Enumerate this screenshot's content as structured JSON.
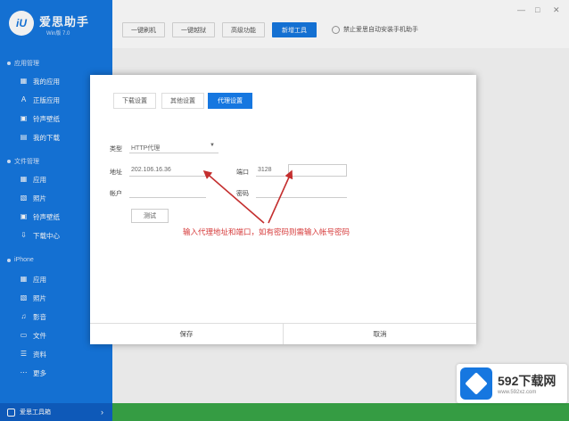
{
  "app": {
    "name": "爱思助手",
    "version": "Win版 7.0"
  },
  "window_controls": [
    "—",
    "□",
    "✕"
  ],
  "sidebar": {
    "groups": [
      {
        "title": "应用管理",
        "items": [
          {
            "label": "我的应用",
            "icon": "apps-icon"
          },
          {
            "label": "正版应用",
            "icon": "appstore-icon"
          },
          {
            "label": "铃声壁纸",
            "icon": "wallpaper-icon"
          },
          {
            "label": "我的下载",
            "icon": "download-icon"
          }
        ]
      },
      {
        "title": "文件管理",
        "items": [
          {
            "label": "应用",
            "icon": "apps-icon"
          },
          {
            "label": "照片",
            "icon": "photo-icon"
          },
          {
            "label": "铃声壁纸",
            "icon": "wallpaper-icon"
          },
          {
            "label": "下载中心",
            "icon": "download-icon"
          }
        ]
      },
      {
        "title": "iPhone",
        "items": [
          {
            "label": "应用",
            "icon": "apps-icon"
          },
          {
            "label": "照片",
            "icon": "photo-icon"
          },
          {
            "label": "影音",
            "icon": "media-icon"
          },
          {
            "label": "文件",
            "icon": "file-icon"
          },
          {
            "label": "资料",
            "icon": "info-icon"
          },
          {
            "label": "更多",
            "icon": "more-icon"
          }
        ]
      }
    ],
    "bottom_label": "爱思工具箱"
  },
  "toolbar": {
    "buttons": [
      "一键刷机",
      "一键越狱",
      "高级功能",
      "新增工具"
    ],
    "active_index": 3,
    "checkbox_label": "禁止爱思自动安装手机助手"
  },
  "modal": {
    "tabs": [
      "下载设置",
      "其他设置",
      "代理设置"
    ],
    "active_tab": 2,
    "type_label": "类型",
    "type_value": "HTTP代理",
    "address_label": "地址",
    "address_value": "202.106.16.36",
    "port_label": "端口",
    "port_value": "3128",
    "account_label": "帐户",
    "password_label": "密码",
    "test_button": "测试",
    "save_button": "保存",
    "cancel_button": "取消",
    "annotation": "输入代理地址和端口，如有密码则需输入帐号密码"
  },
  "watermark": {
    "name": "592下载网",
    "url": "www.592xz.com"
  },
  "colors": {
    "brand": "#1677e0",
    "annotation": "#d63a3a",
    "bottom_bar": "#39a648"
  }
}
